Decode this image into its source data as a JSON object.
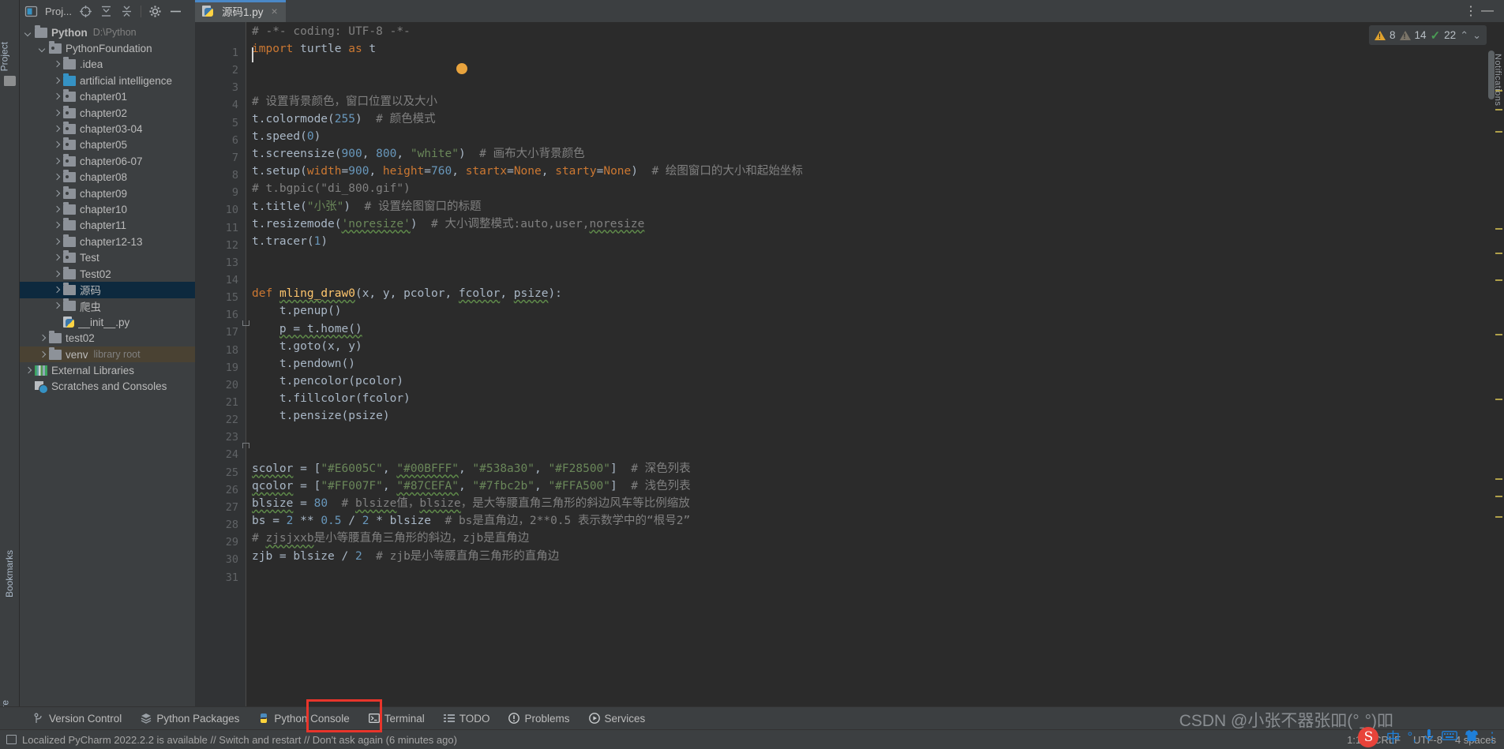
{
  "left_strip": {
    "project_label": "Project",
    "bookmarks_label": "Bookmarks",
    "structure_label": "Structure"
  },
  "sidebar": {
    "title": "Proj...",
    "header_icons": [
      "project-view-icon",
      "expand-all-icon",
      "collapse-all-icon",
      "settings-gear-icon",
      "hide-icon"
    ],
    "tree": [
      {
        "indent": 0,
        "arrow": "down",
        "icon": "folder",
        "label": "Python",
        "sub": "D:\\Python",
        "bold": true,
        "state": "normal"
      },
      {
        "indent": 1,
        "arrow": "down",
        "icon": "folder-dot",
        "label": "PythonFoundation",
        "sub": "",
        "bold": false,
        "state": "normal"
      },
      {
        "indent": 2,
        "arrow": "right",
        "icon": "folder",
        "label": ".idea",
        "sub": "",
        "bold": false,
        "state": "normal"
      },
      {
        "indent": 2,
        "arrow": "right",
        "icon": "folder-blue",
        "label": "artificial intelligence",
        "sub": "",
        "bold": false,
        "state": "normal"
      },
      {
        "indent": 2,
        "arrow": "right",
        "icon": "folder-dot",
        "label": "chapter01",
        "sub": "",
        "bold": false,
        "state": "normal"
      },
      {
        "indent": 2,
        "arrow": "right",
        "icon": "folder-dot",
        "label": "chapter02",
        "sub": "",
        "bold": false,
        "state": "normal"
      },
      {
        "indent": 2,
        "arrow": "right",
        "icon": "folder-dot",
        "label": "chapter03-04",
        "sub": "",
        "bold": false,
        "state": "normal"
      },
      {
        "indent": 2,
        "arrow": "right",
        "icon": "folder-dot",
        "label": "chapter05",
        "sub": "",
        "bold": false,
        "state": "normal"
      },
      {
        "indent": 2,
        "arrow": "right",
        "icon": "folder-dot",
        "label": "chapter06-07",
        "sub": "",
        "bold": false,
        "state": "normal"
      },
      {
        "indent": 2,
        "arrow": "right",
        "icon": "folder-dot",
        "label": "chapter08",
        "sub": "",
        "bold": false,
        "state": "normal"
      },
      {
        "indent": 2,
        "arrow": "right",
        "icon": "folder-dot",
        "label": "chapter09",
        "sub": "",
        "bold": false,
        "state": "normal"
      },
      {
        "indent": 2,
        "arrow": "right",
        "icon": "folder",
        "label": "chapter10",
        "sub": "",
        "bold": false,
        "state": "normal"
      },
      {
        "indent": 2,
        "arrow": "right",
        "icon": "folder",
        "label": "chapter11",
        "sub": "",
        "bold": false,
        "state": "normal"
      },
      {
        "indent": 2,
        "arrow": "right",
        "icon": "folder",
        "label": "chapter12-13",
        "sub": "",
        "bold": false,
        "state": "normal"
      },
      {
        "indent": 2,
        "arrow": "right",
        "icon": "folder-dot",
        "label": "Test",
        "sub": "",
        "bold": false,
        "state": "normal"
      },
      {
        "indent": 2,
        "arrow": "right",
        "icon": "folder",
        "label": "Test02",
        "sub": "",
        "bold": false,
        "state": "normal"
      },
      {
        "indent": 2,
        "arrow": "right",
        "icon": "folder",
        "label": "源码",
        "sub": "",
        "bold": false,
        "state": "selected"
      },
      {
        "indent": 2,
        "arrow": "right",
        "icon": "folder",
        "label": "爬虫",
        "sub": "",
        "bold": false,
        "state": "normal"
      },
      {
        "indent": 2,
        "arrow": "none",
        "icon": "python-file",
        "label": "__init__.py",
        "sub": "",
        "bold": false,
        "state": "normal"
      },
      {
        "indent": 1,
        "arrow": "right",
        "icon": "folder",
        "label": "test02",
        "sub": "",
        "bold": false,
        "state": "normal"
      },
      {
        "indent": 1,
        "arrow": "right",
        "icon": "folder",
        "label": "venv",
        "sub": "library root",
        "bold": false,
        "state": "highlighted"
      },
      {
        "indent": 0,
        "arrow": "right",
        "icon": "library",
        "label": "External Libraries",
        "sub": "",
        "bold": false,
        "state": "normal"
      },
      {
        "indent": 0,
        "arrow": "none",
        "icon": "scratches",
        "label": "Scratches and Consoles",
        "sub": "",
        "bold": false,
        "state": "normal"
      }
    ]
  },
  "editor": {
    "tab": {
      "label": "源码1.py",
      "icon": "python-file-icon",
      "close_label": "×"
    },
    "window_controls": {
      "more_label": "⋮",
      "minimize_label": "—"
    },
    "inspections": {
      "warning_count": "8",
      "weak_warning_count": "14",
      "ok_count": "22",
      "up_label": "⌃",
      "down_label": "⌄"
    },
    "notification_label": "Notifications",
    "lines": [
      {
        "n": 1,
        "tokens": [
          {
            "t": "# -*- coding: UTF-8 -*-",
            "c": "cmt"
          }
        ]
      },
      {
        "n": 2,
        "tokens": [
          {
            "t": "import",
            "c": "kw"
          },
          {
            "t": " turtle ",
            "c": "id"
          },
          {
            "t": "as",
            "c": "kw"
          },
          {
            "t": " t",
            "c": "id"
          }
        ]
      },
      {
        "n": 3,
        "tokens": []
      },
      {
        "n": 4,
        "tokens": []
      },
      {
        "n": 5,
        "tokens": [
          {
            "t": "# 设置背景颜色，窗口位置以及大小",
            "c": "cmt"
          }
        ]
      },
      {
        "n": 6,
        "tokens": [
          {
            "t": "t.colormode(",
            "c": "id"
          },
          {
            "t": "255",
            "c": "num"
          },
          {
            "t": ")",
            "c": "id"
          },
          {
            "t": "  # 颜色模式",
            "c": "cmt"
          }
        ]
      },
      {
        "n": 7,
        "tokens": [
          {
            "t": "t.speed(",
            "c": "id"
          },
          {
            "t": "0",
            "c": "num"
          },
          {
            "t": ")",
            "c": "id"
          }
        ]
      },
      {
        "n": 8,
        "tokens": [
          {
            "t": "t.screensize(",
            "c": "id"
          },
          {
            "t": "900",
            "c": "num"
          },
          {
            "t": ", ",
            "c": "id"
          },
          {
            "t": "800",
            "c": "num"
          },
          {
            "t": ", ",
            "c": "id"
          },
          {
            "t": "\"white\"",
            "c": "str"
          },
          {
            "t": ")",
            "c": "id"
          },
          {
            "t": "  # 画布大小背景颜色",
            "c": "cmt"
          }
        ]
      },
      {
        "n": 9,
        "tokens": [
          {
            "t": "t.setup(",
            "c": "id"
          },
          {
            "t": "width",
            "c": "par"
          },
          {
            "t": "=",
            "c": "id"
          },
          {
            "t": "900",
            "c": "num"
          },
          {
            "t": ", ",
            "c": "id"
          },
          {
            "t": "height",
            "c": "par"
          },
          {
            "t": "=",
            "c": "id"
          },
          {
            "t": "760",
            "c": "num"
          },
          {
            "t": ", ",
            "c": "id"
          },
          {
            "t": "startx",
            "c": "par"
          },
          {
            "t": "=",
            "c": "id"
          },
          {
            "t": "None",
            "c": "kw"
          },
          {
            "t": ", ",
            "c": "id"
          },
          {
            "t": "starty",
            "c": "par"
          },
          {
            "t": "=",
            "c": "id"
          },
          {
            "t": "None",
            "c": "kw"
          },
          {
            "t": ")",
            "c": "id"
          },
          {
            "t": "  # 绘图窗口的大小和起始坐标",
            "c": "cmt"
          }
        ]
      },
      {
        "n": 10,
        "tokens": [
          {
            "t": "# t.bgpic(\"di_800.gif\")",
            "c": "cmt"
          }
        ]
      },
      {
        "n": 11,
        "tokens": [
          {
            "t": "t.title(",
            "c": "id"
          },
          {
            "t": "\"小张\"",
            "c": "str"
          },
          {
            "t": ")",
            "c": "id"
          },
          {
            "t": "  # 设置绘图窗口的标题",
            "c": "cmt"
          }
        ]
      },
      {
        "n": 12,
        "tokens": [
          {
            "t": "t.resizemode(",
            "c": "id"
          },
          {
            "t": "'noresize'",
            "c": "str wavy"
          },
          {
            "t": ")",
            "c": "id"
          },
          {
            "t": "  # 大小调整模式:auto,user,",
            "c": "cmt"
          },
          {
            "t": "noresize",
            "c": "cmt wavy"
          }
        ]
      },
      {
        "n": 13,
        "tokens": [
          {
            "t": "t.tracer(",
            "c": "id"
          },
          {
            "t": "1",
            "c": "num"
          },
          {
            "t": ")",
            "c": "id"
          }
        ]
      },
      {
        "n": 14,
        "tokens": []
      },
      {
        "n": 15,
        "tokens": []
      },
      {
        "n": 16,
        "tokens": [
          {
            "t": "def",
            "c": "kw"
          },
          {
            "t": " ",
            "c": "id"
          },
          {
            "t": "mling_draw0",
            "c": "fn wavy"
          },
          {
            "t": "(x, y, pcolor, ",
            "c": "id"
          },
          {
            "t": "fcolor",
            "c": "id wavy"
          },
          {
            "t": ", ",
            "c": "id"
          },
          {
            "t": "psize",
            "c": "id wavy"
          },
          {
            "t": "):",
            "c": "id"
          }
        ]
      },
      {
        "n": 17,
        "tokens": [
          {
            "t": "    t.penup()",
            "c": "id"
          }
        ]
      },
      {
        "n": 18,
        "tokens": [
          {
            "t": "    ",
            "c": "id"
          },
          {
            "t": "p = t.home()",
            "c": "id wavy"
          }
        ]
      },
      {
        "n": 19,
        "tokens": [
          {
            "t": "    t.goto(x, y)",
            "c": "id"
          }
        ]
      },
      {
        "n": 20,
        "tokens": [
          {
            "t": "    t.pendown()",
            "c": "id"
          }
        ]
      },
      {
        "n": 21,
        "tokens": [
          {
            "t": "    t.pencolor(pcolor)",
            "c": "id"
          }
        ]
      },
      {
        "n": 22,
        "tokens": [
          {
            "t": "    t.fillcolor(fcolor)",
            "c": "id"
          }
        ]
      },
      {
        "n": 23,
        "tokens": [
          {
            "t": "    t.pensize(psize)",
            "c": "id"
          }
        ]
      },
      {
        "n": 24,
        "tokens": []
      },
      {
        "n": 25,
        "tokens": []
      },
      {
        "n": 26,
        "tokens": [
          {
            "t": "scolor",
            "c": "id wavy"
          },
          {
            "t": " = [",
            "c": "id"
          },
          {
            "t": "\"#E6005C\"",
            "c": "str"
          },
          {
            "t": ", ",
            "c": "id"
          },
          {
            "t": "\"#00BFFF\"",
            "c": "str wavy"
          },
          {
            "t": ", ",
            "c": "id"
          },
          {
            "t": "\"#538a30\"",
            "c": "str"
          },
          {
            "t": ", ",
            "c": "id"
          },
          {
            "t": "\"#F28500\"",
            "c": "str"
          },
          {
            "t": "]",
            "c": "id"
          },
          {
            "t": "  # 深色列表",
            "c": "cmt"
          }
        ]
      },
      {
        "n": 27,
        "tokens": [
          {
            "t": "qcolor",
            "c": "id wavy"
          },
          {
            "t": " = [",
            "c": "id"
          },
          {
            "t": "\"#FF007F\"",
            "c": "str"
          },
          {
            "t": ", ",
            "c": "id"
          },
          {
            "t": "\"#87CEFA\"",
            "c": "str wavy"
          },
          {
            "t": ", ",
            "c": "id"
          },
          {
            "t": "\"#7fbc2b\"",
            "c": "str"
          },
          {
            "t": ", ",
            "c": "id"
          },
          {
            "t": "\"#FFA500\"",
            "c": "str"
          },
          {
            "t": "]",
            "c": "id"
          },
          {
            "t": "  # 浅色列表",
            "c": "cmt"
          }
        ]
      },
      {
        "n": 28,
        "tokens": [
          {
            "t": "blsize",
            "c": "id wavy"
          },
          {
            "t": " = ",
            "c": "id"
          },
          {
            "t": "80",
            "c": "num"
          },
          {
            "t": "  # ",
            "c": "cmt"
          },
          {
            "t": "blsize",
            "c": "cmt wavy"
          },
          {
            "t": "值，",
            "c": "cmt"
          },
          {
            "t": "blsize",
            "c": "cmt wavy"
          },
          {
            "t": "，是大等腰直角三角形的斜边风车等比例缩放",
            "c": "cmt"
          }
        ]
      },
      {
        "n": 29,
        "tokens": [
          {
            "t": "bs = ",
            "c": "id"
          },
          {
            "t": "2",
            "c": "num"
          },
          {
            "t": " ** ",
            "c": "id"
          },
          {
            "t": "0.5",
            "c": "num"
          },
          {
            "t": " / ",
            "c": "id"
          },
          {
            "t": "2",
            "c": "num"
          },
          {
            "t": " * blsize",
            "c": "id"
          },
          {
            "t": "  # bs是直角边，2**0.5 表示数学中的“根号2”",
            "c": "cmt"
          }
        ]
      },
      {
        "n": 30,
        "tokens": [
          {
            "t": "# ",
            "c": "cmt"
          },
          {
            "t": "zjsjxxb",
            "c": "cmt wavy"
          },
          {
            "t": "是小等腰直角三角形的斜边，zjb是直角边",
            "c": "cmt"
          }
        ]
      },
      {
        "n": 31,
        "tokens": [
          {
            "t": "zjb = blsize / ",
            "c": "id"
          },
          {
            "t": "2",
            "c": "num"
          },
          {
            "t": "  # zjb是小等腰直角三角形的直角边",
            "c": "cmt"
          }
        ]
      }
    ]
  },
  "tool_window_bar": {
    "items": [
      {
        "label": "Version Control",
        "icon": "branch-icon"
      },
      {
        "label": "Python Packages",
        "icon": "packages-icon"
      },
      {
        "label": "Python Console",
        "icon": "python-console-icon"
      },
      {
        "label": "Terminal",
        "icon": "terminal-icon"
      },
      {
        "label": "TODO",
        "icon": "todo-list-icon"
      },
      {
        "label": "Problems",
        "icon": "problems-icon"
      },
      {
        "label": "Services",
        "icon": "services-play-icon"
      }
    ],
    "highlighted_item": "Terminal",
    "highlight_color": "#e8352b"
  },
  "status_bar": {
    "message": "Localized PyCharm 2022.2.2 is available // Switch and restart // Don't ask again (6 minutes ago)",
    "caret_position": "1:1",
    "line_separator": "CRLF",
    "encoding": "UTF-8",
    "indent": "4 spaces"
  },
  "overlay": {
    "watermark": "CSDN @小张不器张吅(°ˍ°)吅",
    "ime": {
      "logo": "S",
      "mode": "中",
      "punctuation": "°,",
      "voice": "ᵠ",
      "keyboard": "⌨",
      "toolbox": "▼",
      "more": "⋮"
    }
  }
}
